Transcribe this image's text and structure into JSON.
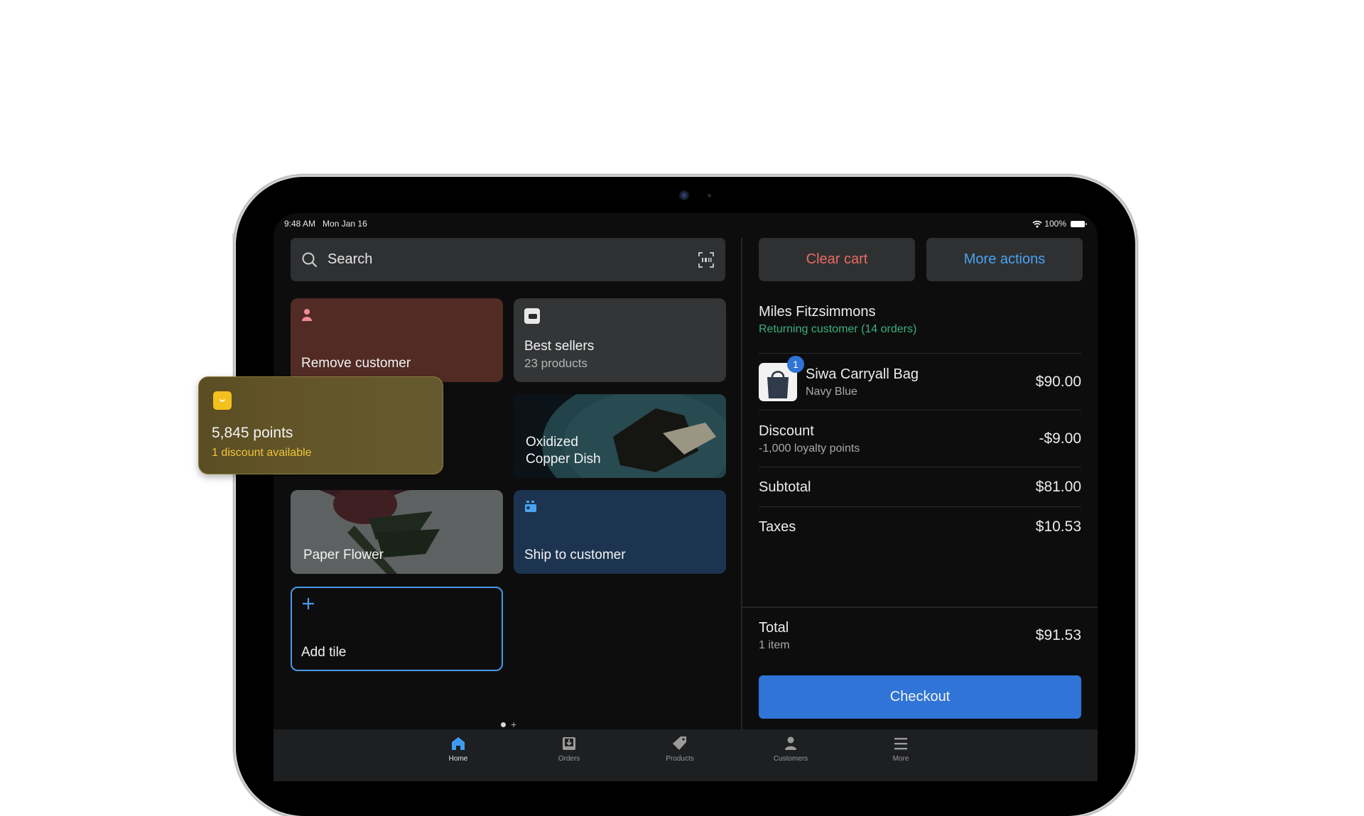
{
  "status_bar": {
    "time": "9:48 AM",
    "date": "Mon Jan 16",
    "battery": "100%"
  },
  "search": {
    "placeholder": "Search",
    "value": ""
  },
  "tiles": [
    {
      "label": "Remove customer",
      "icon": "person-icon"
    },
    {
      "label": "Best sellers",
      "sublabel": "23 products",
      "icon": "product-thumbnail"
    },
    {
      "label": "Oxidized Copper Dish",
      "line1": "Oxidized",
      "line2": "Copper Dish"
    },
    {
      "label": "Paper Flower"
    },
    {
      "label": "Ship to customer",
      "icon": "shipping-box-icon"
    },
    {
      "label": "Add tile",
      "icon": "plus-icon"
    }
  ],
  "loyalty": {
    "points": "5,845 points",
    "discounts": "1 discount available"
  },
  "cart": {
    "clear_label": "Clear cart",
    "more_label": "More actions",
    "customer": {
      "name": "Miles Fitzsimmons",
      "status": "Returning customer (14 orders)"
    },
    "items": [
      {
        "name": "Siwa Carryall Bag",
        "variant": "Navy Blue",
        "price": "$90.00",
        "quantity": "1"
      }
    ],
    "discount": {
      "label": "Discount",
      "detail": "-1,000 loyalty points",
      "amount": "-$9.00"
    },
    "subtotal": {
      "label": "Subtotal",
      "amount": "$81.00"
    },
    "taxes": {
      "label": "Taxes",
      "amount": "$10.53"
    },
    "total": {
      "label": "Total",
      "detail": "1 item",
      "amount": "$91.53"
    },
    "checkout_label": "Checkout"
  },
  "nav": [
    {
      "label": "Home",
      "active": true
    },
    {
      "label": "Orders"
    },
    {
      "label": "Products"
    },
    {
      "label": "Customers"
    },
    {
      "label": "More"
    }
  ],
  "colors": {
    "accent": "#2f74d6",
    "danger": "#ec6a62",
    "link": "#4aa2f0",
    "success": "#3bb07c",
    "loyalty": "#f4c01e"
  }
}
